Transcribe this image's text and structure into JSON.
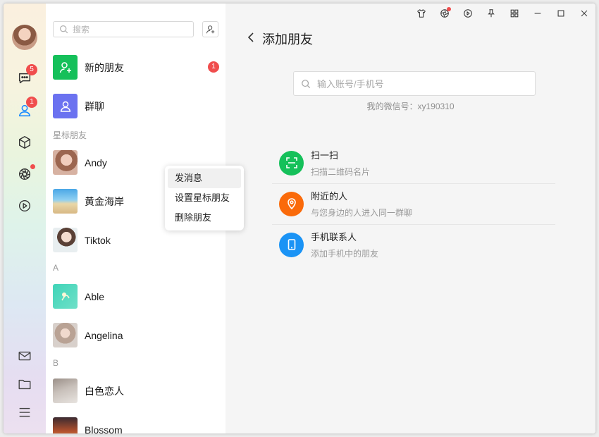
{
  "sidebar": {
    "chats_badge": "5",
    "contacts_badge": "1"
  },
  "contacts_panel": {
    "search_placeholder": "搜索",
    "new_friends_label": "新的朋友",
    "new_friends_badge": "1",
    "group_chat_label": "群聊",
    "sections": [
      "星标朋友",
      "A",
      "B"
    ],
    "starred": [
      "Andy",
      "黄金海岸",
      "Tiktok"
    ],
    "a_contacts": [
      "Able",
      "Angelina"
    ],
    "b_contacts": [
      "白色恋人",
      "Blossom"
    ]
  },
  "context_menu": {
    "items": [
      "发消息",
      "设置星标朋友",
      "删除朋友"
    ]
  },
  "add_friend": {
    "title": "添加朋友",
    "search_placeholder": "输入账号/手机号",
    "my_id": "我的微信号：xy190310",
    "options": [
      {
        "title": "扫一扫",
        "subtitle": "扫描二维码名片"
      },
      {
        "title": "附近的人",
        "subtitle": "与您身边的人进入同一群聊"
      },
      {
        "title": "手机联系人",
        "subtitle": "添加手机中的朋友"
      }
    ]
  },
  "colors": {
    "green": "#15c05a",
    "purple": "#6b72f0",
    "orange": "#fa6a0a",
    "blue": "#1a93f5",
    "badge_red": "#f04d4d",
    "active_blue": "#1a8cff"
  }
}
